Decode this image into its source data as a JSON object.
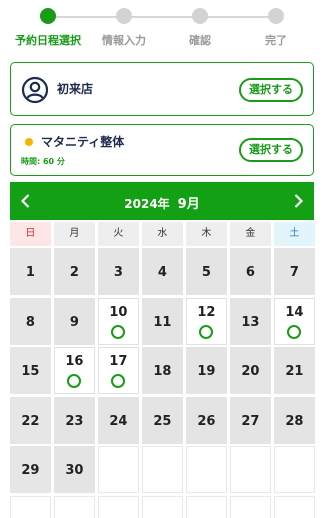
{
  "stepper": {
    "steps": [
      {
        "label": "予約日程選択",
        "active": true
      },
      {
        "label": "情報入力",
        "active": false
      },
      {
        "label": "確認",
        "active": false
      },
      {
        "label": "完了",
        "active": false
      }
    ]
  },
  "store_card": {
    "title": "初来店",
    "icon": "person-circle-icon",
    "button_label": "選択する"
  },
  "menu_card": {
    "name": "マタニティ整体",
    "time": "時間: 60 分",
    "button_label": "選択する"
  },
  "calendar": {
    "year_label": "2024年",
    "month_label": "9月",
    "prev_icon": "chevron-left-icon",
    "next_icon": "chevron-right-icon",
    "weekdays": [
      "日",
      "月",
      "火",
      "水",
      "木",
      "金",
      "土"
    ],
    "days": [
      {
        "n": "1",
        "avail": false
      },
      {
        "n": "2",
        "avail": false
      },
      {
        "n": "3",
        "avail": false
      },
      {
        "n": "4",
        "avail": false
      },
      {
        "n": "5",
        "avail": false
      },
      {
        "n": "6",
        "avail": false
      },
      {
        "n": "7",
        "avail": false
      },
      {
        "n": "8",
        "avail": false
      },
      {
        "n": "9",
        "avail": false
      },
      {
        "n": "10",
        "avail": true
      },
      {
        "n": "11",
        "avail": false
      },
      {
        "n": "12",
        "avail": true
      },
      {
        "n": "13",
        "avail": false
      },
      {
        "n": "14",
        "avail": true
      },
      {
        "n": "15",
        "avail": false
      },
      {
        "n": "16",
        "avail": true
      },
      {
        "n": "17",
        "avail": true
      },
      {
        "n": "18",
        "avail": false
      },
      {
        "n": "19",
        "avail": false
      },
      {
        "n": "20",
        "avail": false
      },
      {
        "n": "21",
        "avail": false
      },
      {
        "n": "22",
        "avail": false
      },
      {
        "n": "23",
        "avail": false
      },
      {
        "n": "24",
        "avail": false
      },
      {
        "n": "25",
        "avail": false
      },
      {
        "n": "26",
        "avail": false
      },
      {
        "n": "27",
        "avail": false
      },
      {
        "n": "28",
        "avail": false
      },
      {
        "n": "29",
        "avail": false
      },
      {
        "n": "30",
        "avail": false
      },
      {
        "n": "",
        "avail": false
      },
      {
        "n": "",
        "avail": false
      },
      {
        "n": "",
        "avail": false
      },
      {
        "n": "",
        "avail": false
      },
      {
        "n": "",
        "avail": false
      },
      {
        "n": "",
        "avail": false
      },
      {
        "n": "",
        "avail": false
      },
      {
        "n": "",
        "avail": false
      },
      {
        "n": "",
        "avail": false
      },
      {
        "n": "",
        "avail": false
      },
      {
        "n": "",
        "avail": false
      },
      {
        "n": "",
        "avail": false
      }
    ]
  },
  "colors": {
    "brand_green": "#1a9b1a",
    "reserve_dot": "#f5b400",
    "sunday": "#d32f2f",
    "saturday": "#2b7cc4"
  }
}
